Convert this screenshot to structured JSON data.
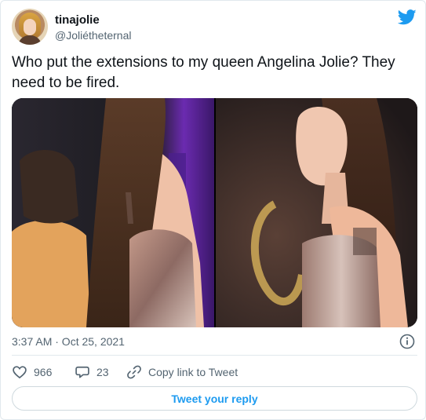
{
  "tweet": {
    "user": {
      "display_name": "tinajolie",
      "handle": "@Joliétheternal",
      "avatar_icon": "avatar"
    },
    "brand_icon": "twitter-bird-icon",
    "text": "Who put the extensions to my queen Angelina Jolie? They need to be fired.",
    "media_count": 2,
    "timestamp": "3:37 AM · Oct 25, 2021",
    "info_icon": "info-icon",
    "actions": {
      "likes": "966",
      "replies": "23",
      "copy_link_label": "Copy link to Tweet"
    },
    "reply_button_label": "Tweet your reply"
  },
  "colors": {
    "accent": "#1d9bf0",
    "secondary_text": "#536471",
    "border": "#e1e8ed"
  }
}
